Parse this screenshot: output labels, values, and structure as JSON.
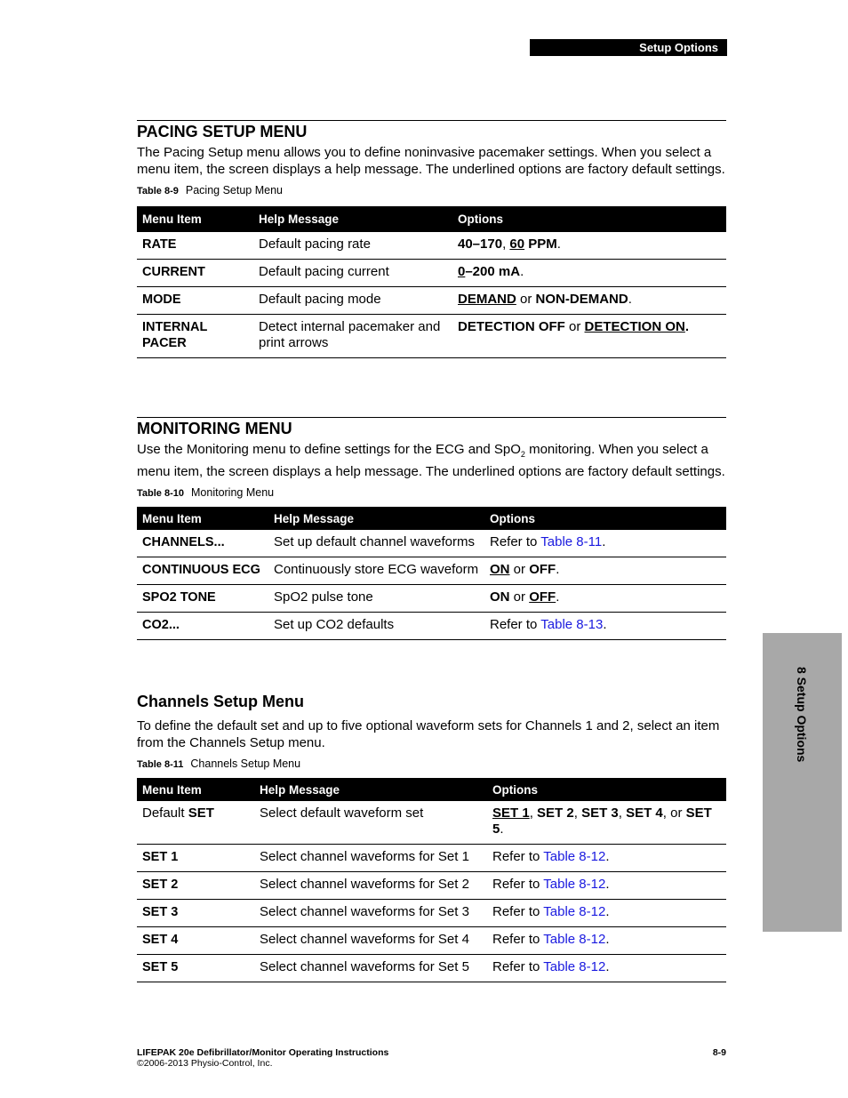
{
  "header": {
    "section_tab": "Setup Options"
  },
  "side_tab": {
    "label": "8 Setup Options"
  },
  "pacing": {
    "title": "PACING SETUP MENU",
    "intro": "The Pacing Setup menu allows you to define noninvasive pacemaker settings. When you select a menu item, the screen displays a help message. The underlined options are factory default settings.",
    "caption_num": "Table 8-9",
    "caption_text": "Pacing Setup Menu",
    "columns": [
      "Menu Item",
      "Help Message",
      "Options"
    ],
    "rows": [
      {
        "item": "RATE",
        "help": "Default pacing rate",
        "options": [
          {
            "t": "40–170",
            "b": true
          },
          {
            "t": ", "
          },
          {
            "t": "60",
            "b": true,
            "u": true
          },
          {
            "t": " PPM",
            "b": true
          },
          {
            "t": "."
          }
        ]
      },
      {
        "item": "CURRENT",
        "help": "Default pacing current",
        "options": [
          {
            "t": "0",
            "b": true,
            "u": true
          },
          {
            "t": "–200 mA",
            "b": true
          },
          {
            "t": "."
          }
        ]
      },
      {
        "item": "MODE",
        "help": "Default pacing mode",
        "options": [
          {
            "t": "DEMAND",
            "b": true,
            "u": true
          },
          {
            "t": " or "
          },
          {
            "t": "NON-DEMAND",
            "b": true
          },
          {
            "t": "."
          }
        ]
      },
      {
        "item": "INTERNAL PACER",
        "help": "Detect internal pacemaker and print arrows",
        "options": [
          {
            "t": "DETECTION OFF",
            "b": true
          },
          {
            "t": " or "
          },
          {
            "t": "DETECTION ON",
            "b": true,
            "u": true
          },
          {
            "t": ".",
            "b": true
          }
        ]
      }
    ]
  },
  "monitoring": {
    "title": "MONITORING MENU",
    "intro_before_sub": "Use the Monitoring menu to define settings for the ECG and SpO",
    "intro_sub": "2",
    "intro_after_sub": " monitoring. When you select a menu item, the screen displays a help message. The underlined options are factory default settings.",
    "caption_num": "Table 8-10",
    "caption_text": "Monitoring Menu",
    "columns": [
      "Menu Item",
      "Help Message",
      "Options"
    ],
    "rows": [
      {
        "item": "CHANNELS...",
        "help": "Set up default channel waveforms",
        "options": [
          {
            "t": "Refer to "
          },
          {
            "t": "Table 8-11",
            "link": true
          },
          {
            "t": "."
          }
        ]
      },
      {
        "item": "CONTINUOUS ECG",
        "help": "Continuously store ECG waveform",
        "options": [
          {
            "t": "ON",
            "b": true,
            "u": true
          },
          {
            "t": " or "
          },
          {
            "t": "OFF",
            "b": true
          },
          {
            "t": "."
          }
        ]
      },
      {
        "item": "SPO2 TONE",
        "help": "SpO2 pulse tone",
        "options": [
          {
            "t": "ON",
            "b": true
          },
          {
            "t": " or "
          },
          {
            "t": "OFF",
            "b": true,
            "u": true
          },
          {
            "t": "."
          }
        ]
      },
      {
        "item": "CO2...",
        "help": "Set up CO2 defaults",
        "options": [
          {
            "t": "Refer to "
          },
          {
            "t": "Table 8-13",
            "link": true
          },
          {
            "t": "."
          }
        ]
      }
    ]
  },
  "channels": {
    "title": "Channels Setup Menu",
    "intro": "To define the default set and up to five optional waveform sets for Channels 1 and 2, select an item from the Channels Setup menu.",
    "caption_num": "Table 8-11",
    "caption_text": "Channels Setup Menu",
    "columns": [
      "Menu Item",
      "Help Message",
      "Options"
    ],
    "rows": [
      {
        "item_parts": [
          {
            "t": "Default "
          },
          {
            "t": "SET",
            "b": true
          }
        ],
        "help": "Select default waveform set",
        "options": [
          {
            "t": "SET 1",
            "b": true,
            "u": true
          },
          {
            "t": ", "
          },
          {
            "t": "SET 2",
            "b": true
          },
          {
            "t": ", "
          },
          {
            "t": "SET 3",
            "b": true
          },
          {
            "t": ", "
          },
          {
            "t": "SET 4",
            "b": true
          },
          {
            "t": ", or "
          },
          {
            "t": "SET 5",
            "b": true
          },
          {
            "t": "."
          }
        ]
      },
      {
        "item": "SET 1",
        "help": "Select channel waveforms for Set 1",
        "options": [
          {
            "t": "Refer to "
          },
          {
            "t": "Table 8-12",
            "link": true
          },
          {
            "t": "."
          }
        ]
      },
      {
        "item": "SET 2",
        "help": "Select channel waveforms for Set 2",
        "options": [
          {
            "t": "Refer to "
          },
          {
            "t": "Table 8-12",
            "link": true
          },
          {
            "t": "."
          }
        ]
      },
      {
        "item": "SET 3",
        "help": "Select channel waveforms for Set 3",
        "options": [
          {
            "t": "Refer to "
          },
          {
            "t": "Table 8-12",
            "link": true
          },
          {
            "t": "."
          }
        ]
      },
      {
        "item": "SET 4",
        "help": "Select channel waveforms for Set 4",
        "options": [
          {
            "t": "Refer to "
          },
          {
            "t": "Table 8-12",
            "link": true
          },
          {
            "t": "."
          }
        ]
      },
      {
        "item": "SET 5",
        "help": "Select channel waveforms for Set 5",
        "options": [
          {
            "t": "Refer to "
          },
          {
            "t": "Table 8-12",
            "link": true
          },
          {
            "t": "."
          }
        ]
      }
    ]
  },
  "footer": {
    "title": "LIFEPAK 20e Defibrillator/Monitor Operating Instructions",
    "copyright": "©2006-2013 Physio-Control, Inc.",
    "page_number": "8-9"
  },
  "colors": {
    "link": "#1a1adf",
    "side_tab_bg": "#a8a8a8",
    "header_bg": "#000000"
  }
}
